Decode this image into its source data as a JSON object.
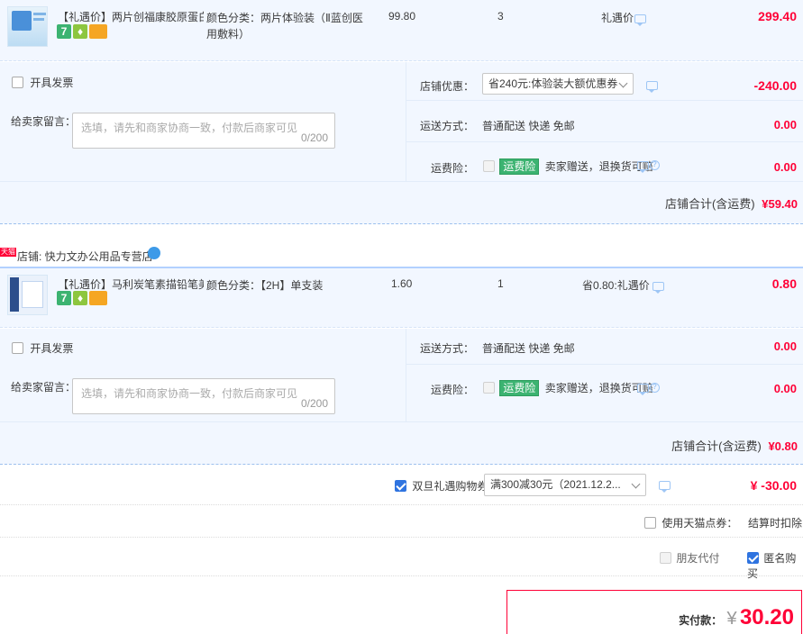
{
  "shop1": {
    "item": {
      "title": "【礼遇价】两片创福康胶原蛋白...",
      "sku_line1": "颜色分类：两片体验装（Ⅱ蓝创医",
      "sku_line2": "用敷料）",
      "unit_price": "99.80",
      "quantity": "3",
      "discount": "礼遇价",
      "subtotal": "299.40",
      "thumb_text": "一次性使用创福康医用敷料"
    },
    "invoice_label": "开具发票",
    "message_label": "给卖家留言：",
    "message_placeholder": "选填，请先和商家协商一致，付款后商家可见",
    "message_count": "0/200",
    "coupon_label": "店铺优惠：",
    "coupon_value": "省240元:体验装大额优惠券",
    "coupon_amount": "-240.00",
    "shipping_label": "运送方式：",
    "shipping_value": "普通配送 快递 免邮",
    "shipping_amount": "0.00",
    "insurance_label": "运费险：",
    "insurance_tag": "运费险",
    "insurance_text": "卖家赠送，退换货可赔",
    "insurance_amount": "0.00",
    "total_label": "店铺合计(含运费)",
    "total_value": "¥59.40"
  },
  "shop2": {
    "store_badge": "天猫",
    "store_name": "店铺: 快力文办公用品专营店",
    "item": {
      "title": "【礼遇价】马利炭笔素描铅笔美...",
      "sku": "颜色分类：【2H】单支装",
      "unit_price": "1.60",
      "quantity": "1",
      "discount": "省0.80:礼遇价",
      "subtotal": "0.80"
    },
    "invoice_label": "开具发票",
    "message_label": "给卖家留言：",
    "message_placeholder": "选填，请先和商家协商一致，付款后商家可见",
    "message_count": "0/200",
    "shipping_label": "运送方式：",
    "shipping_value": "普通配送 快递 免邮",
    "shipping_amount": "0.00",
    "insurance_label": "运费险：",
    "insurance_tag": "运费险",
    "insurance_text": "卖家赠送，退换货可赔",
    "insurance_amount": "0.00",
    "total_label": "店铺合计(含运费)",
    "total_value": "¥0.80"
  },
  "platform_coupon": {
    "label": "双旦礼遇购物券",
    "value": "满300减30元（2021.12.2...",
    "amount": "¥ -30.00"
  },
  "tmall_points": {
    "label": "使用天猫点券：",
    "note": "结算时扣除"
  },
  "options": {
    "friend_pay": "朋友代付",
    "anonymous": "匿名购买"
  },
  "summary": {
    "label": "实付款：",
    "currency": "¥",
    "amount": "30.20"
  },
  "colors": {
    "price": "#ff0036",
    "section_bg": "#f2f7ff",
    "accent_blue": "#2f74e0"
  }
}
